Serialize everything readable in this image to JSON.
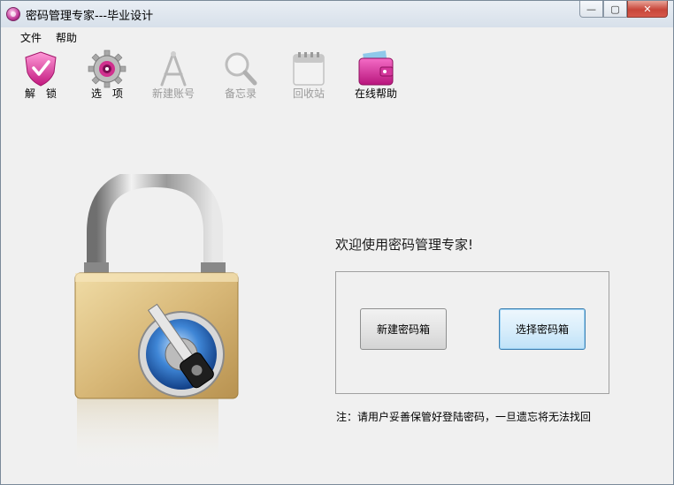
{
  "window": {
    "title": "密码管理专家---毕业设计",
    "controls": {
      "minimize": "—",
      "maximize": "▢",
      "close": "✕"
    }
  },
  "menubar": {
    "items": [
      {
        "label": "文件"
      },
      {
        "label": "帮助"
      }
    ]
  },
  "toolbar": {
    "items": [
      {
        "label": "解　锁",
        "icon": "shield-heart-icon",
        "enabled": true
      },
      {
        "label": "选　项",
        "icon": "gear-icon",
        "enabled": true
      },
      {
        "label": "新建账号",
        "icon": "drafting-compass-icon",
        "enabled": false
      },
      {
        "label": "备忘录",
        "icon": "magnifier-icon",
        "enabled": false
      },
      {
        "label": "回收站",
        "icon": "calendar-icon",
        "enabled": false
      },
      {
        "label": "在线帮助",
        "icon": "wallet-icon",
        "enabled": true
      }
    ]
  },
  "main": {
    "welcome": "欢迎使用密码管理专家!",
    "buttons": {
      "new_vault": "新建密码箱",
      "select_vault": "选择密码箱"
    },
    "note": "注：请用户妥善保管好登陆密码，一旦遗忘将无法找回"
  },
  "colors": {
    "window_bg": "#f0f0f0",
    "close_button": "#c8463a",
    "lock_body": "#d8b878",
    "focus_border": "#3c7fb1"
  }
}
